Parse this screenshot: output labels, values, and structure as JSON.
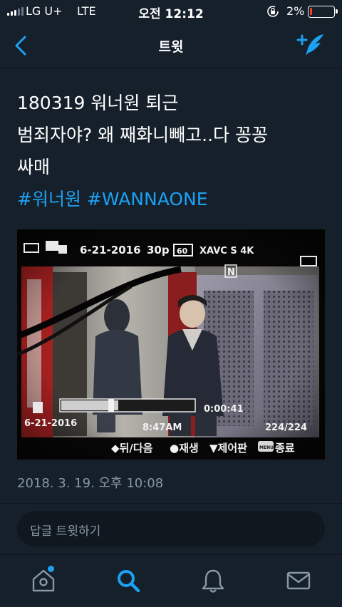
{
  "status": {
    "carrier": "LG U+",
    "network": "LTE",
    "time": "오전 12:12",
    "battery_percent": "2%",
    "battery_level": 0.02
  },
  "nav": {
    "title": "트윗",
    "back_icon": "chevron-left-icon",
    "compose_icon": "compose-tweet-icon"
  },
  "tweet": {
    "lines": [
      "180319 워너원 퇴근",
      "범죄자야? 왜 째화니빼고..다 꽁꽁",
      "싸매"
    ],
    "hashtags": [
      "#워너원",
      "#WANNAONE"
    ],
    "timestamp": "2018. 3. 19. 오후 10:08",
    "photo": {
      "date_top": "6-21-2016",
      "fps": "30p",
      "fps_box": "60",
      "format": "XAVC S 4K",
      "date_bottom": "6-21-2016",
      "clock": "8:47AM",
      "counter": "0:00:41",
      "file_index": "224/224",
      "nav_label": "◆뒤/다음",
      "play_label": "●재생",
      "control_label": "▼제어판",
      "menu_box": "MENU",
      "end_label": "종료",
      "n_mark": "N"
    }
  },
  "reply": {
    "placeholder": "답글 트윗하기"
  },
  "tabs": {
    "home": "home-icon",
    "search": "search-icon",
    "notifications": "bell-icon",
    "messages": "envelope-icon",
    "active": "search"
  },
  "colors": {
    "background": "#15202b",
    "accent": "#1da1f2",
    "muted": "#8899a6",
    "battery_low": "#ff3b30"
  }
}
